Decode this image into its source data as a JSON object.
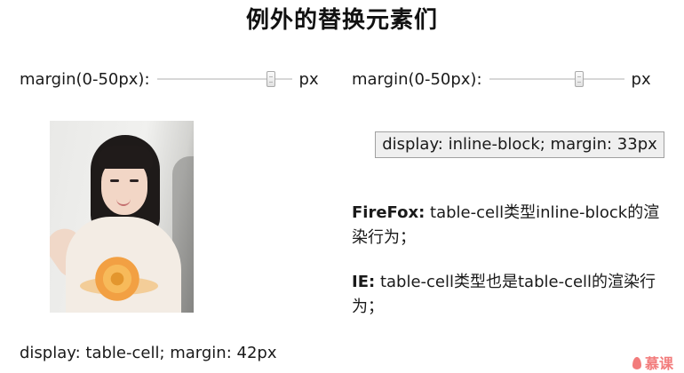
{
  "title": "例外的替换元素们",
  "left_slider": {
    "label": "margin(0-50px):",
    "unit": "px",
    "value": 42,
    "min": 0,
    "max": 50
  },
  "right_slider": {
    "label": "margin(0-50px):",
    "unit": "px",
    "value": 33,
    "min": 0,
    "max": 50
  },
  "inline_block_box": {
    "text": "display: inline-block; margin: 33px"
  },
  "notes": [
    {
      "label": "FireFox:",
      "line1": "table-cell类型inline-block的渲",
      "line2": "染行为；"
    },
    {
      "label": "IE:",
      "line1": "table-cell类型也是table-cell的渲染行",
      "line2": "为；"
    }
  ],
  "caption": "display: table-cell; margin: 42px",
  "watermark": "慕课"
}
